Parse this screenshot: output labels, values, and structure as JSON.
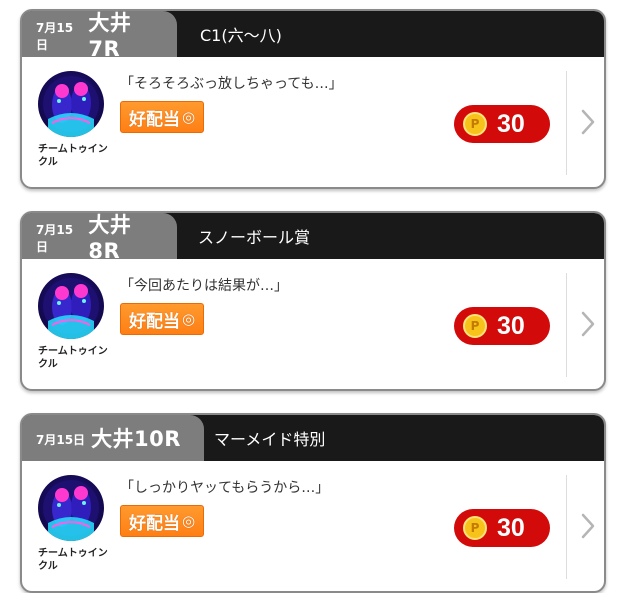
{
  "cards": [
    {
      "date": "7月15日",
      "race": "大井7R",
      "title": "C1(六〜八)",
      "comment": "「そろそろぶっ放しちゃっても…」",
      "author": "チームトゥインクル",
      "badge": "好配当",
      "badge_mark": "◎",
      "price": "30",
      "coin_label": "P"
    },
    {
      "date": "7月15日",
      "race": "大井8R",
      "title": "スノーボール賞",
      "comment": "「今回あたりは結果が…」",
      "author": "チームトゥインクル",
      "badge": "好配当",
      "badge_mark": "◎",
      "price": "30",
      "coin_label": "P"
    },
    {
      "date": "7月15日",
      "race": "大井10R",
      "title": "マーメイド特別",
      "comment": "「しっかりヤッてもらうから…」",
      "author": "チームトゥインクル",
      "badge": "好配当",
      "badge_mark": "◎",
      "price": "30",
      "coin_label": "P"
    }
  ],
  "colors": {
    "header_dark": "#191919",
    "header_tag": "#7d7d7d",
    "badge_orange": "#ff8a1e",
    "price_red": "#d20a0a",
    "coin_gold": "#f7c21a"
  },
  "icons": {
    "avatar": "team-twinkle-avatar",
    "coin": "point-coin-icon",
    "chevron": "chevron-right-icon"
  }
}
